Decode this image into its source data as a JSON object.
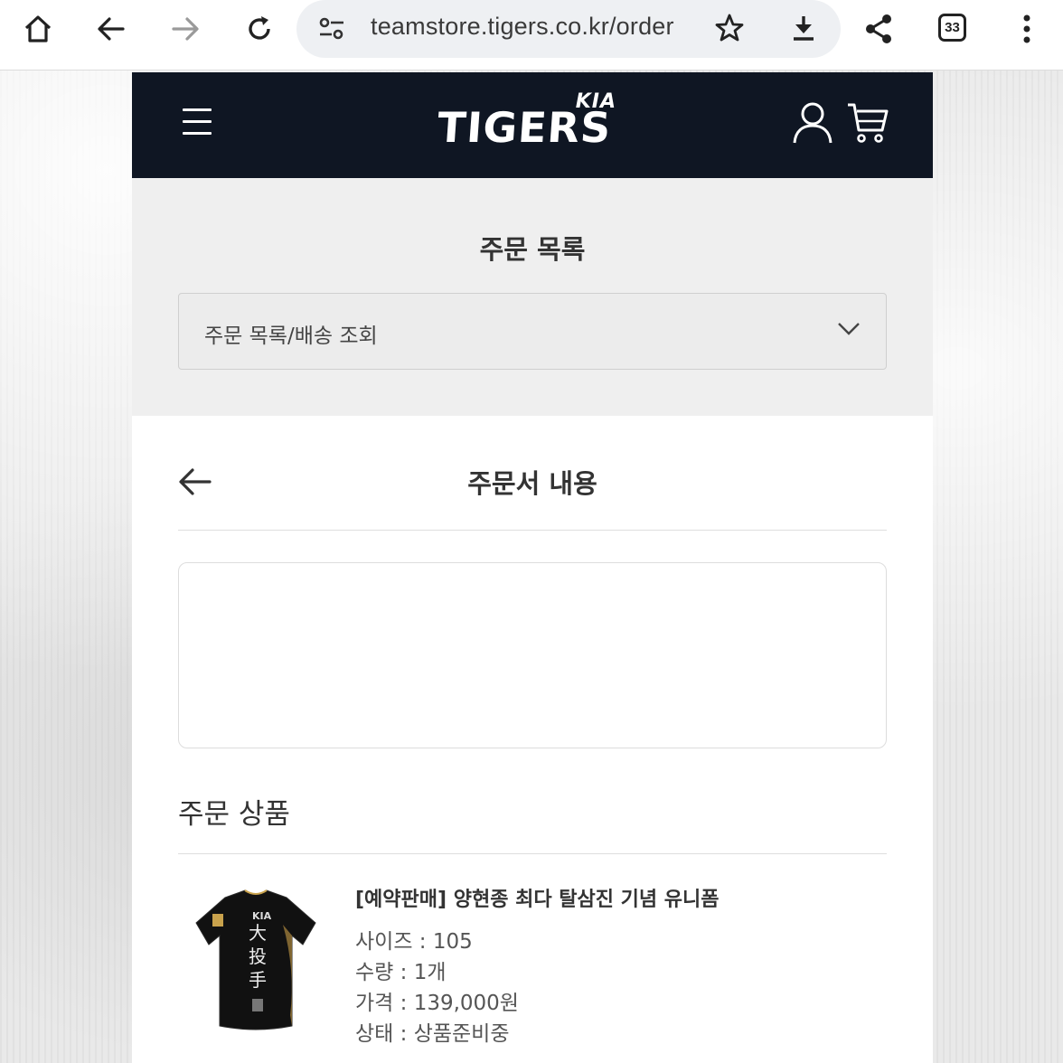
{
  "browser": {
    "url": "teamstore.tigers.co.kr/order",
    "tab_count": "33",
    "icons": [
      "home-icon",
      "back-icon",
      "forward-icon",
      "reload-icon",
      "site-settings-icon",
      "star-icon",
      "download-icon",
      "share-icon",
      "tabs-icon",
      "more-icon"
    ]
  },
  "nav": {
    "logo_mark": "KIA",
    "logo_word": "TIGERS"
  },
  "order_list": {
    "title": "주문 목록",
    "select_value": "주문 목록/배송 조회"
  },
  "detail": {
    "title": "주문서 내용"
  },
  "items_section": {
    "title": "주문 상품",
    "products": [
      {
        "name": "[예약판매] 양현종 최다 탈삼진 기념 유니폼",
        "size": "사이즈 : 105",
        "qty": "수량 : 1개",
        "price": "가격 : 139,000원",
        "status": "상태 : 상품준비중"
      }
    ]
  },
  "colors": {
    "nav_bg": "#0f1623",
    "section_bg": "#efefef"
  }
}
